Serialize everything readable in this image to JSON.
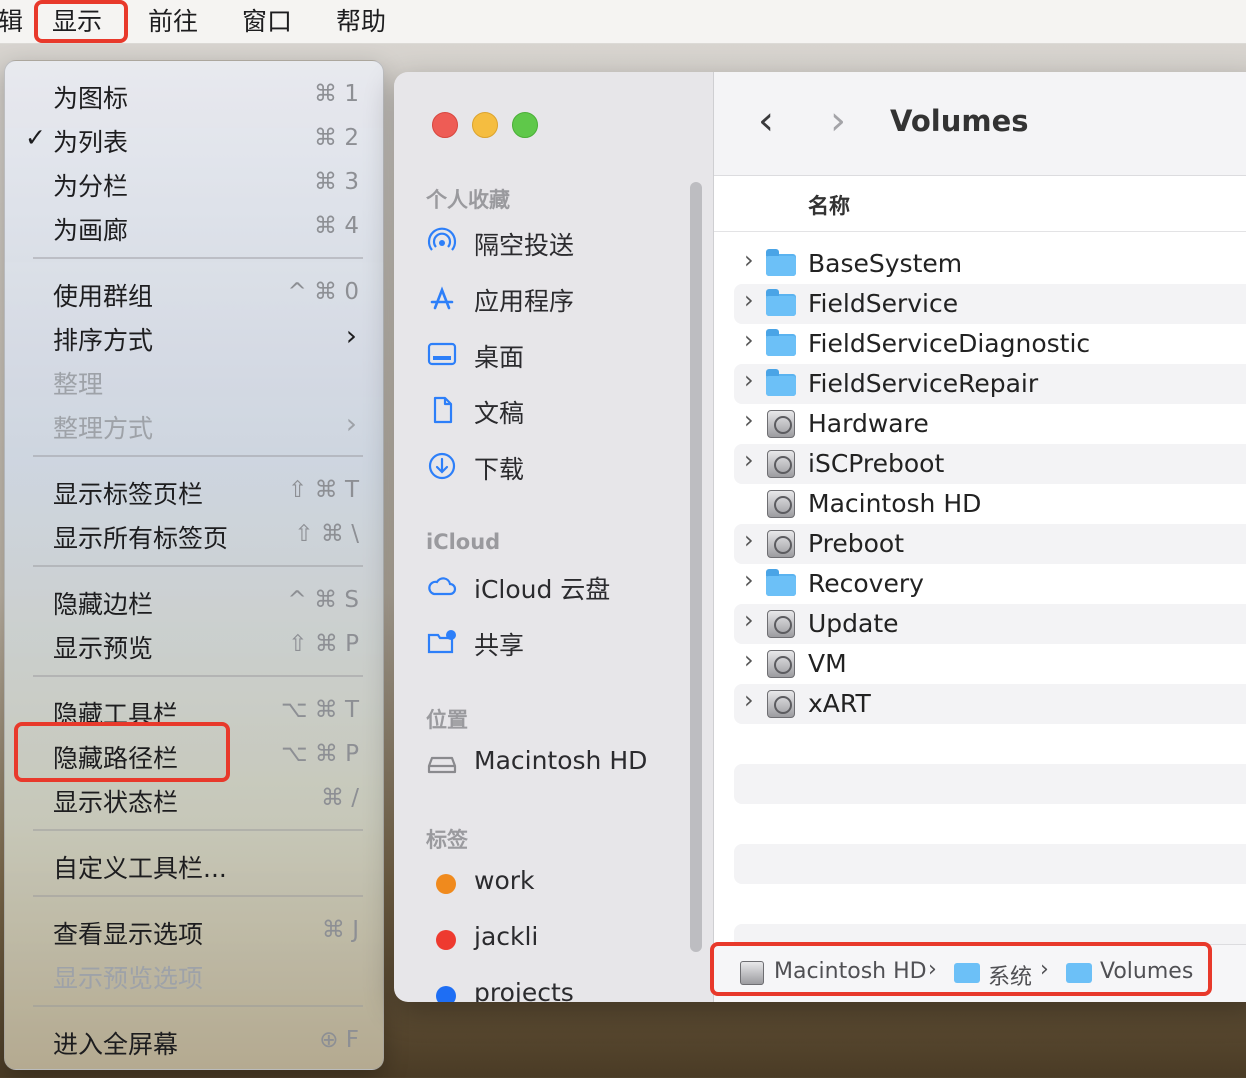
{
  "menubar": {
    "cut_item": "辑",
    "active_item": "显示",
    "items": [
      "前往",
      "窗口",
      "帮助"
    ]
  },
  "menu": {
    "items": [
      {
        "label": "为图标",
        "shortcut": "⌘ 1"
      },
      {
        "label": "为列表",
        "shortcut": "⌘ 2",
        "checked": "✓"
      },
      {
        "label": "为分栏",
        "shortcut": "⌘ 3"
      },
      {
        "label": "为画廊",
        "shortcut": "⌘ 4"
      },
      {
        "label": "使用群组",
        "shortcut": "^ ⌘ 0"
      },
      {
        "label": "排序方式",
        "submenu": "›"
      },
      {
        "label": "整理",
        "disabled": true
      },
      {
        "label": "整理方式",
        "submenu": "›",
        "disabled": true
      },
      {
        "label": "显示标签页栏",
        "shortcut": "⇧ ⌘ T"
      },
      {
        "label": "显示所有标签页",
        "shortcut": "⇧ ⌘ \\"
      },
      {
        "label": "隐藏边栏",
        "shortcut": "^ ⌘ S"
      },
      {
        "label": "显示预览",
        "shortcut": "⇧ ⌘ P"
      },
      {
        "label": "隐藏工具栏",
        "shortcut": "⌥ ⌘ T"
      },
      {
        "label": "隐藏路径栏",
        "shortcut": "⌥ ⌘ P"
      },
      {
        "label": "显示状态栏",
        "shortcut": "⌘ /"
      },
      {
        "label": "自定义工具栏..."
      },
      {
        "label": "查看显示选项",
        "shortcut": "⌘ J"
      },
      {
        "label": "显示预览选项",
        "disabled": true
      },
      {
        "label": "进入全屏幕",
        "shortcut": "⊕ F"
      }
    ]
  },
  "sidebar": {
    "favorites_header": "个人收藏",
    "favorites": [
      {
        "label": "隔空投送",
        "icon": "airdrop-icon"
      },
      {
        "label": "应用程序",
        "icon": "applications-icon"
      },
      {
        "label": "桌面",
        "icon": "desktop-icon"
      },
      {
        "label": "文稿",
        "icon": "document-icon"
      },
      {
        "label": "下载",
        "icon": "download-icon"
      }
    ],
    "icloud_header": "iCloud",
    "icloud": [
      {
        "label": "iCloud 云盘",
        "icon": "cloud-icon"
      },
      {
        "label": "共享",
        "icon": "shared-folder-icon"
      }
    ],
    "locations_header": "位置",
    "locations": [
      {
        "label": "Macintosh HD",
        "icon": "hard-drive-icon"
      }
    ],
    "tags_header": "标签",
    "tags": [
      {
        "label": "work",
        "color": "#f08a1d"
      },
      {
        "label": "jackli",
        "color": "#ee3a2f"
      },
      {
        "label": "projects",
        "color": "#1e6ef4"
      }
    ]
  },
  "window": {
    "title": "Volumes",
    "column_name": "名称",
    "files": [
      {
        "name": "BaseSystem",
        "type": "folder",
        "expandable": true
      },
      {
        "name": "FieldService",
        "type": "folder",
        "expandable": true
      },
      {
        "name": "FieldServiceDiagnostic",
        "type": "folder",
        "expandable": true
      },
      {
        "name": "FieldServiceRepair",
        "type": "folder",
        "expandable": true
      },
      {
        "name": "Hardware",
        "type": "disk",
        "expandable": true
      },
      {
        "name": "iSCPreboot",
        "type": "disk",
        "expandable": true
      },
      {
        "name": "Macintosh HD",
        "type": "disk",
        "expandable": false
      },
      {
        "name": "Preboot",
        "type": "disk",
        "expandable": true
      },
      {
        "name": "Recovery",
        "type": "folder",
        "expandable": true
      },
      {
        "name": "Update",
        "type": "disk",
        "expandable": true
      },
      {
        "name": "VM",
        "type": "disk",
        "expandable": true
      },
      {
        "name": "xART",
        "type": "disk",
        "expandable": true
      }
    ],
    "pathbar": [
      "Macintosh HD",
      "系统",
      "Volumes"
    ]
  },
  "colors": {
    "highlight": "#e8392b",
    "accent": "#2d7ff9"
  }
}
